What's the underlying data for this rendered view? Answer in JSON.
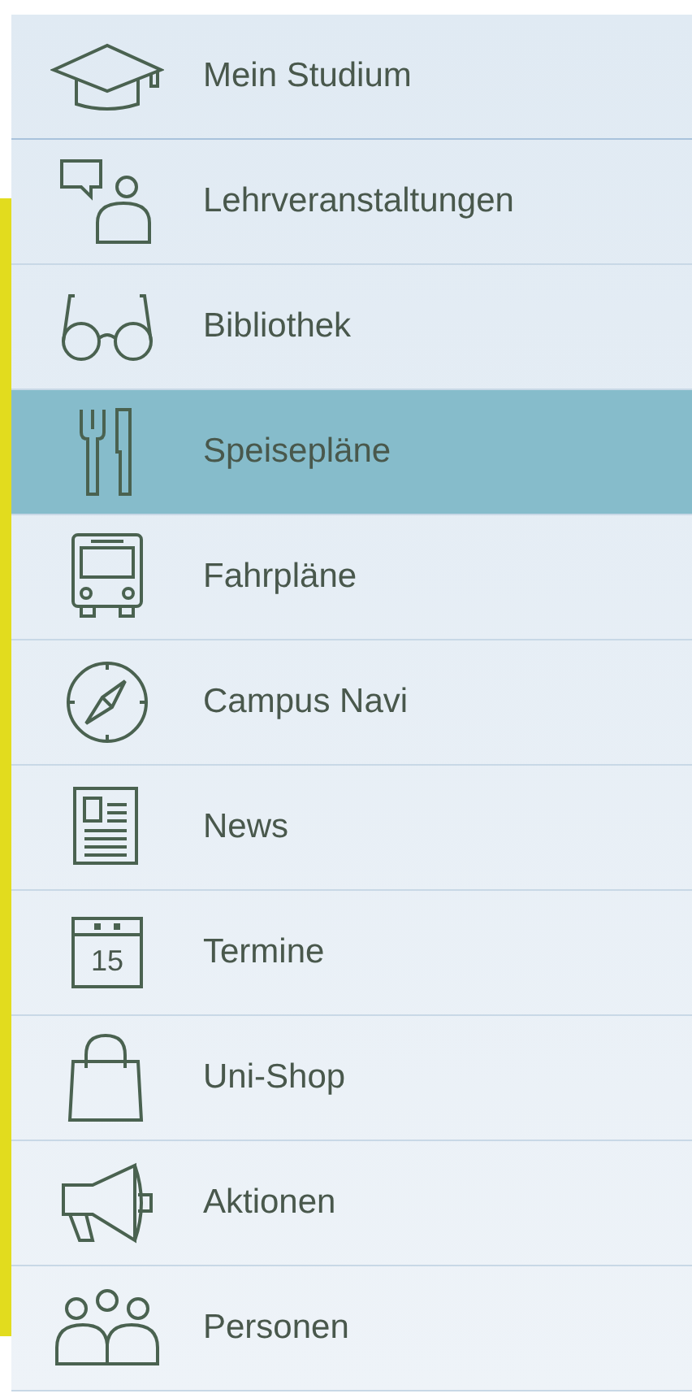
{
  "menu": {
    "items": [
      {
        "label": "Mein Studium",
        "kind": "cap",
        "selected": false
      },
      {
        "label": "Lehrveranstaltungen",
        "kind": "lecture",
        "selected": false
      },
      {
        "label": "Bibliothek",
        "kind": "glasses",
        "selected": false
      },
      {
        "label": "Speisepläne",
        "kind": "cutlery",
        "selected": true
      },
      {
        "label": "Fahrpläne",
        "kind": "bus",
        "selected": false
      },
      {
        "label": "Campus Navi",
        "kind": "compass",
        "selected": false
      },
      {
        "label": "News",
        "kind": "news",
        "selected": false
      },
      {
        "label": "Termine",
        "kind": "calendar",
        "selected": false,
        "icon_text": "15"
      },
      {
        "label": "Uni-Shop",
        "kind": "bag",
        "selected": false
      },
      {
        "label": "Aktionen",
        "kind": "megaphone",
        "selected": false
      },
      {
        "label": "Personen",
        "kind": "people",
        "selected": false
      }
    ]
  }
}
